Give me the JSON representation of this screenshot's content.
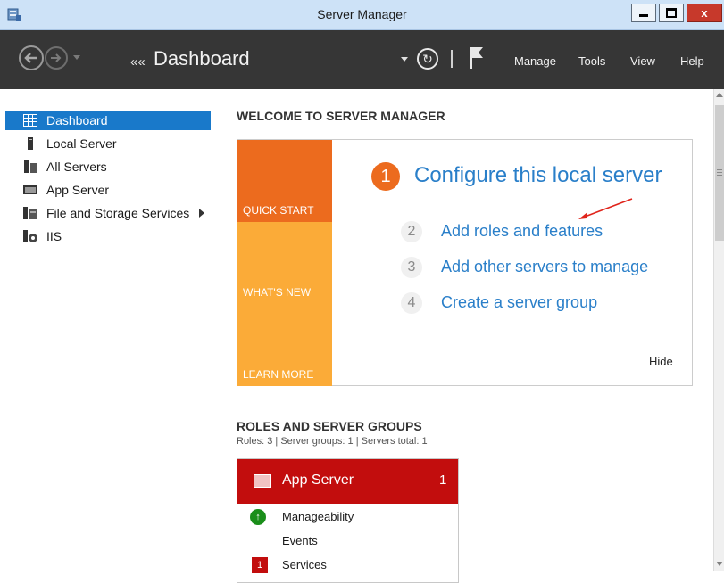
{
  "window": {
    "title": "Server Manager",
    "close_glyph": "x"
  },
  "header": {
    "breadcrumb_arrow": "««",
    "page_title": "Dashboard",
    "menu": [
      "Manage",
      "Tools",
      "View",
      "Help"
    ]
  },
  "sidebar": {
    "items": [
      {
        "label": "Dashboard",
        "icon": "dashboard-grid-icon",
        "selected": true
      },
      {
        "label": "Local Server",
        "icon": "server-icon",
        "selected": false
      },
      {
        "label": "All Servers",
        "icon": "servers-icon",
        "selected": false
      },
      {
        "label": "App Server",
        "icon": "app-server-icon",
        "selected": false
      },
      {
        "label": "File and Storage Services",
        "icon": "file-storage-icon",
        "selected": false
      },
      {
        "label": "IIS",
        "icon": "iis-icon",
        "selected": false
      }
    ]
  },
  "welcome": {
    "heading": "WELCOME TO SERVER MANAGER",
    "tiles": [
      "QUICK START",
      "WHAT'S NEW",
      "LEARN MORE"
    ],
    "steps": [
      {
        "number": "1",
        "label": "Configure this local server"
      },
      {
        "number": "2",
        "label": "Add roles and features"
      },
      {
        "number": "3",
        "label": "Add other servers to manage"
      },
      {
        "number": "4",
        "label": "Create a server group"
      }
    ],
    "hide_label": "Hide"
  },
  "roles": {
    "heading": "ROLES AND SERVER GROUPS",
    "summary": "Roles: 3  |  Server groups: 1  |  Servers total: 1",
    "card": {
      "title": "App Server",
      "count": "1",
      "rows": [
        {
          "label": "Manageability",
          "badge": ""
        },
        {
          "label": "Events",
          "badge": ""
        },
        {
          "label": "Services",
          "badge": "1"
        }
      ]
    }
  },
  "colors": {
    "accent_blue": "#1979ca",
    "quick_start_orange": "#ec6b1e",
    "tile_yellow": "#fbab38",
    "link_blue": "#2a7fc9",
    "server_red": "#c20d0d",
    "header_dark": "#363636"
  }
}
